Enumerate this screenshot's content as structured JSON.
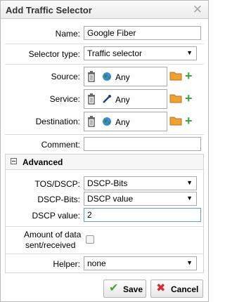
{
  "dialog": {
    "title": "Add Traffic Selector"
  },
  "fields": {
    "name_label": "Name:",
    "name_value": "Google Fiber",
    "selector_type_label": "Selector type:",
    "selector_type_value": "Traffic selector",
    "source_label": "Source:",
    "source_value": "Any",
    "service_label": "Service:",
    "service_value": "Any",
    "destination_label": "Destination:",
    "destination_value": "Any",
    "comment_label": "Comment:",
    "comment_value": ""
  },
  "advanced": {
    "title": "Advanced",
    "tos_label": "TOS/DSCP:",
    "tos_value": "DSCP-Bits",
    "dscp_bits_label": "DSCP-Bits:",
    "dscp_bits_value": "DSCP value",
    "dscp_value_label": "DSCP value:",
    "dscp_value": "2",
    "amount_label_line1": "Amount of data",
    "amount_label_line2": "sent/received",
    "amount_checked": false,
    "helper_label": "Helper:",
    "helper_value": "none"
  },
  "buttons": {
    "save_label": "Save",
    "cancel_label": "Cancel"
  },
  "colors": {
    "plus": "#3ea536",
    "cancel_x": "#d62f2f",
    "save_check": "#3ea536",
    "folder": "#f0a030"
  }
}
